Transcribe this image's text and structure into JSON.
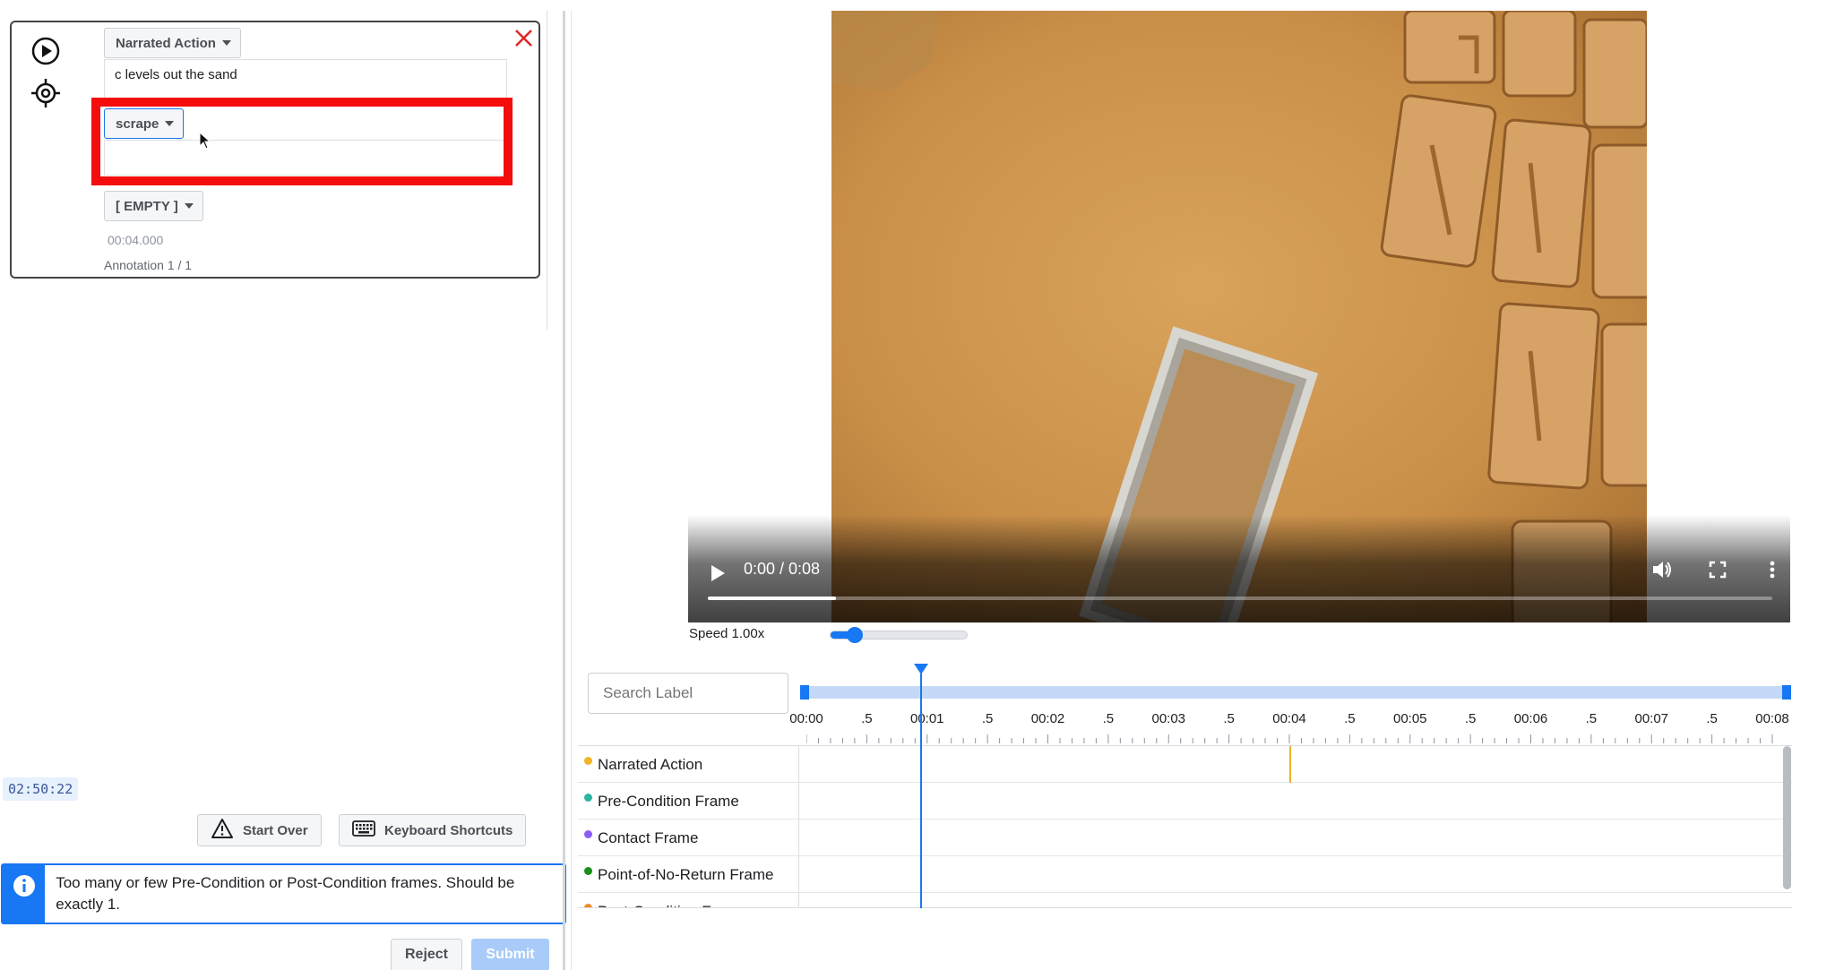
{
  "annotation": {
    "type_dropdown": "Narrated Action",
    "narration_text": "c levels out the sand",
    "verb_dropdown": "scrape",
    "verb_text": "",
    "noun_dropdown": "[ EMPTY ]",
    "timestamp": "00:04.000",
    "counter": "Annotation 1 / 1"
  },
  "timer": "02:50:22",
  "buttons": {
    "start_over": "Start Over",
    "keyboard_shortcuts": "Keyboard Shortcuts",
    "reject": "Reject",
    "submit": "Submit"
  },
  "alert": {
    "message": "Too many or few Pre-Condition or Post-Condition frames. Should be exactly 1."
  },
  "video": {
    "time_display": "0:00 / 0:08",
    "progress": 0.12
  },
  "speed": {
    "label": "Speed 1.00x",
    "value": 0.18
  },
  "search": {
    "placeholder": "Search Label"
  },
  "timeline": {
    "tick_labels": [
      "00:00",
      ".5",
      "00:01",
      ".5",
      "00:02",
      ".5",
      "00:03",
      ".5",
      "00:04",
      ".5",
      "00:05",
      ".5",
      "00:06",
      ".5",
      "00:07",
      ".5",
      "00:08"
    ],
    "playhead_seconds": 0.95,
    "duration_seconds": 8,
    "tracks": [
      {
        "name": "Narrated Action",
        "color": "#f0b429",
        "markers": [
          4.0
        ]
      },
      {
        "name": "Pre-Condition Frame",
        "color": "#2bb5a0",
        "markers": []
      },
      {
        "name": "Contact Frame",
        "color": "#8b5cf6",
        "markers": []
      },
      {
        "name": "Point-of-No-Return Frame",
        "color": "#1a8f1a",
        "markers": []
      },
      {
        "name": "Post-Condition Frame",
        "color": "#f08a24",
        "markers": []
      }
    ]
  },
  "colors": {
    "accent": "#1877f2",
    "highlight": "#f40d0d"
  }
}
